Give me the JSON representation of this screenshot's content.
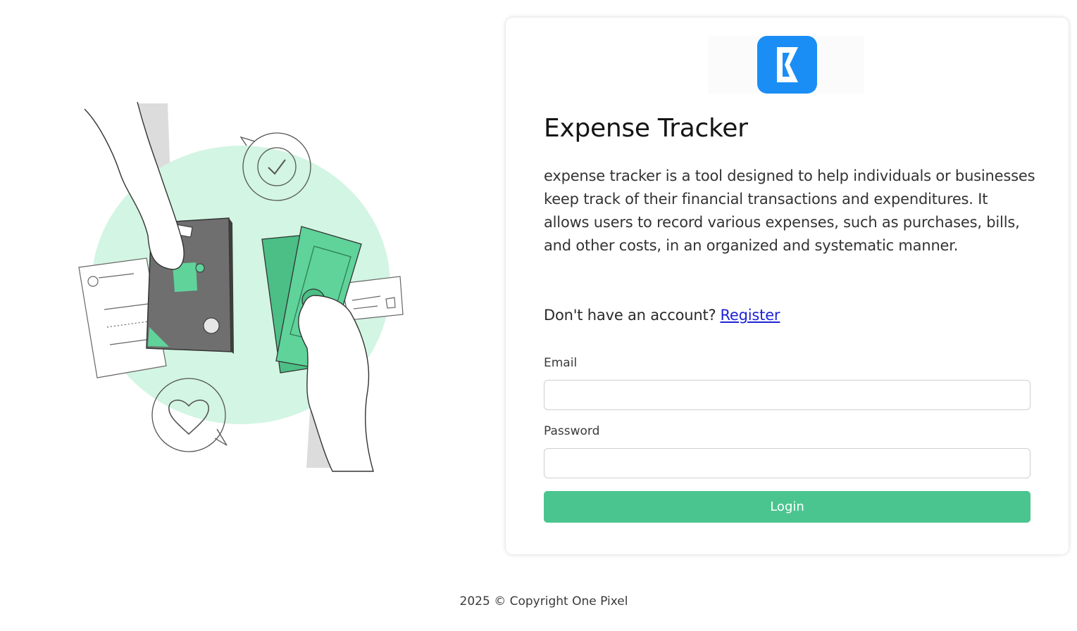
{
  "app": {
    "title": "Expense Tracker",
    "description": "expense tracker is a tool designed to help individuals or businesses keep track of their financial transactions and expenditures. It allows users to record various expenses, such as purchases, bills, and other costs, in an organized and systematic manner."
  },
  "register": {
    "prompt": "Don't have an account?",
    "link_label": "Register"
  },
  "form": {
    "email_label": "Email",
    "email_value": "",
    "password_label": "Password",
    "password_value": "",
    "login_label": "Login"
  },
  "footer": {
    "text": "2025 © Copyright One Pixel"
  },
  "icons": {
    "logo": "expense-tracker-logo-icon",
    "illustration": "money-exchange-illustration"
  },
  "colors": {
    "accent": "#4bc58f",
    "logo_bg": "#1a8ef5",
    "link": "#1d23d6",
    "illustration_blob": "#d3f5e3"
  }
}
